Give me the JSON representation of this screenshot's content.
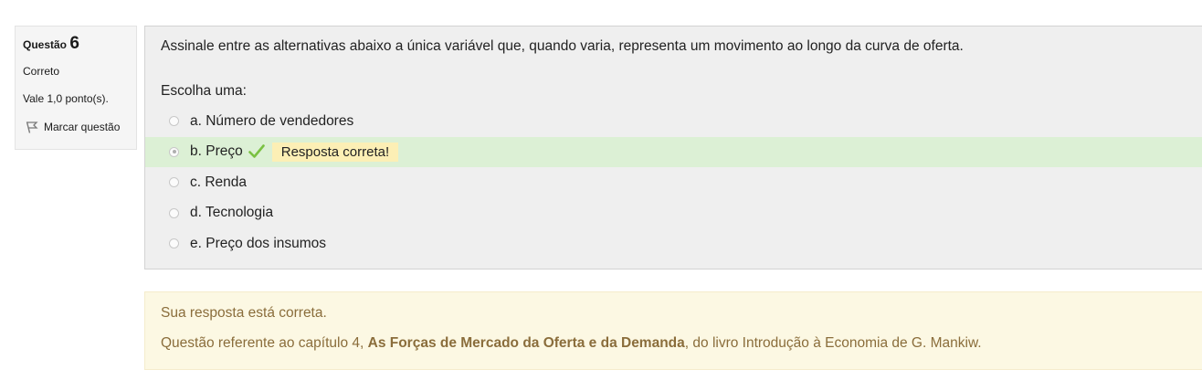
{
  "info": {
    "question_label": "Questão",
    "question_number": "6",
    "state": "Correto",
    "grade": "Vale 1,0 ponto(s).",
    "flag_label": "Marcar questão"
  },
  "question": {
    "text": "Assinale entre as alternativas abaixo a única variável que, quando varia, representa um movimento ao longo da curva de oferta.",
    "prompt": "Escolha uma:",
    "options": [
      {
        "label": "a. Número de vendedores",
        "checked": false
      },
      {
        "label": "b. Preço",
        "checked": true,
        "feedback": "Resposta correta!"
      },
      {
        "label": "c. Renda",
        "checked": false
      },
      {
        "label": "d. Tecnologia",
        "checked": false
      },
      {
        "label": "e. Preço dos insumos",
        "checked": false
      }
    ]
  },
  "outcome": {
    "result": "Sua resposta está correta.",
    "ref_prefix": "Questão referente ao capítulo 4, ",
    "ref_bold": "As Forças de Mercado da Oferta e da Demanda",
    "ref_suffix": ", do livro Introdução à Economia de G. Mankiw."
  },
  "colors": {
    "correct_bg": "#dcf0d5",
    "tick": "#7ac142",
    "badge_bg": "#fcefb5",
    "outcome_bg": "#fcf8e3",
    "outcome_text": "#8a6d3b"
  }
}
